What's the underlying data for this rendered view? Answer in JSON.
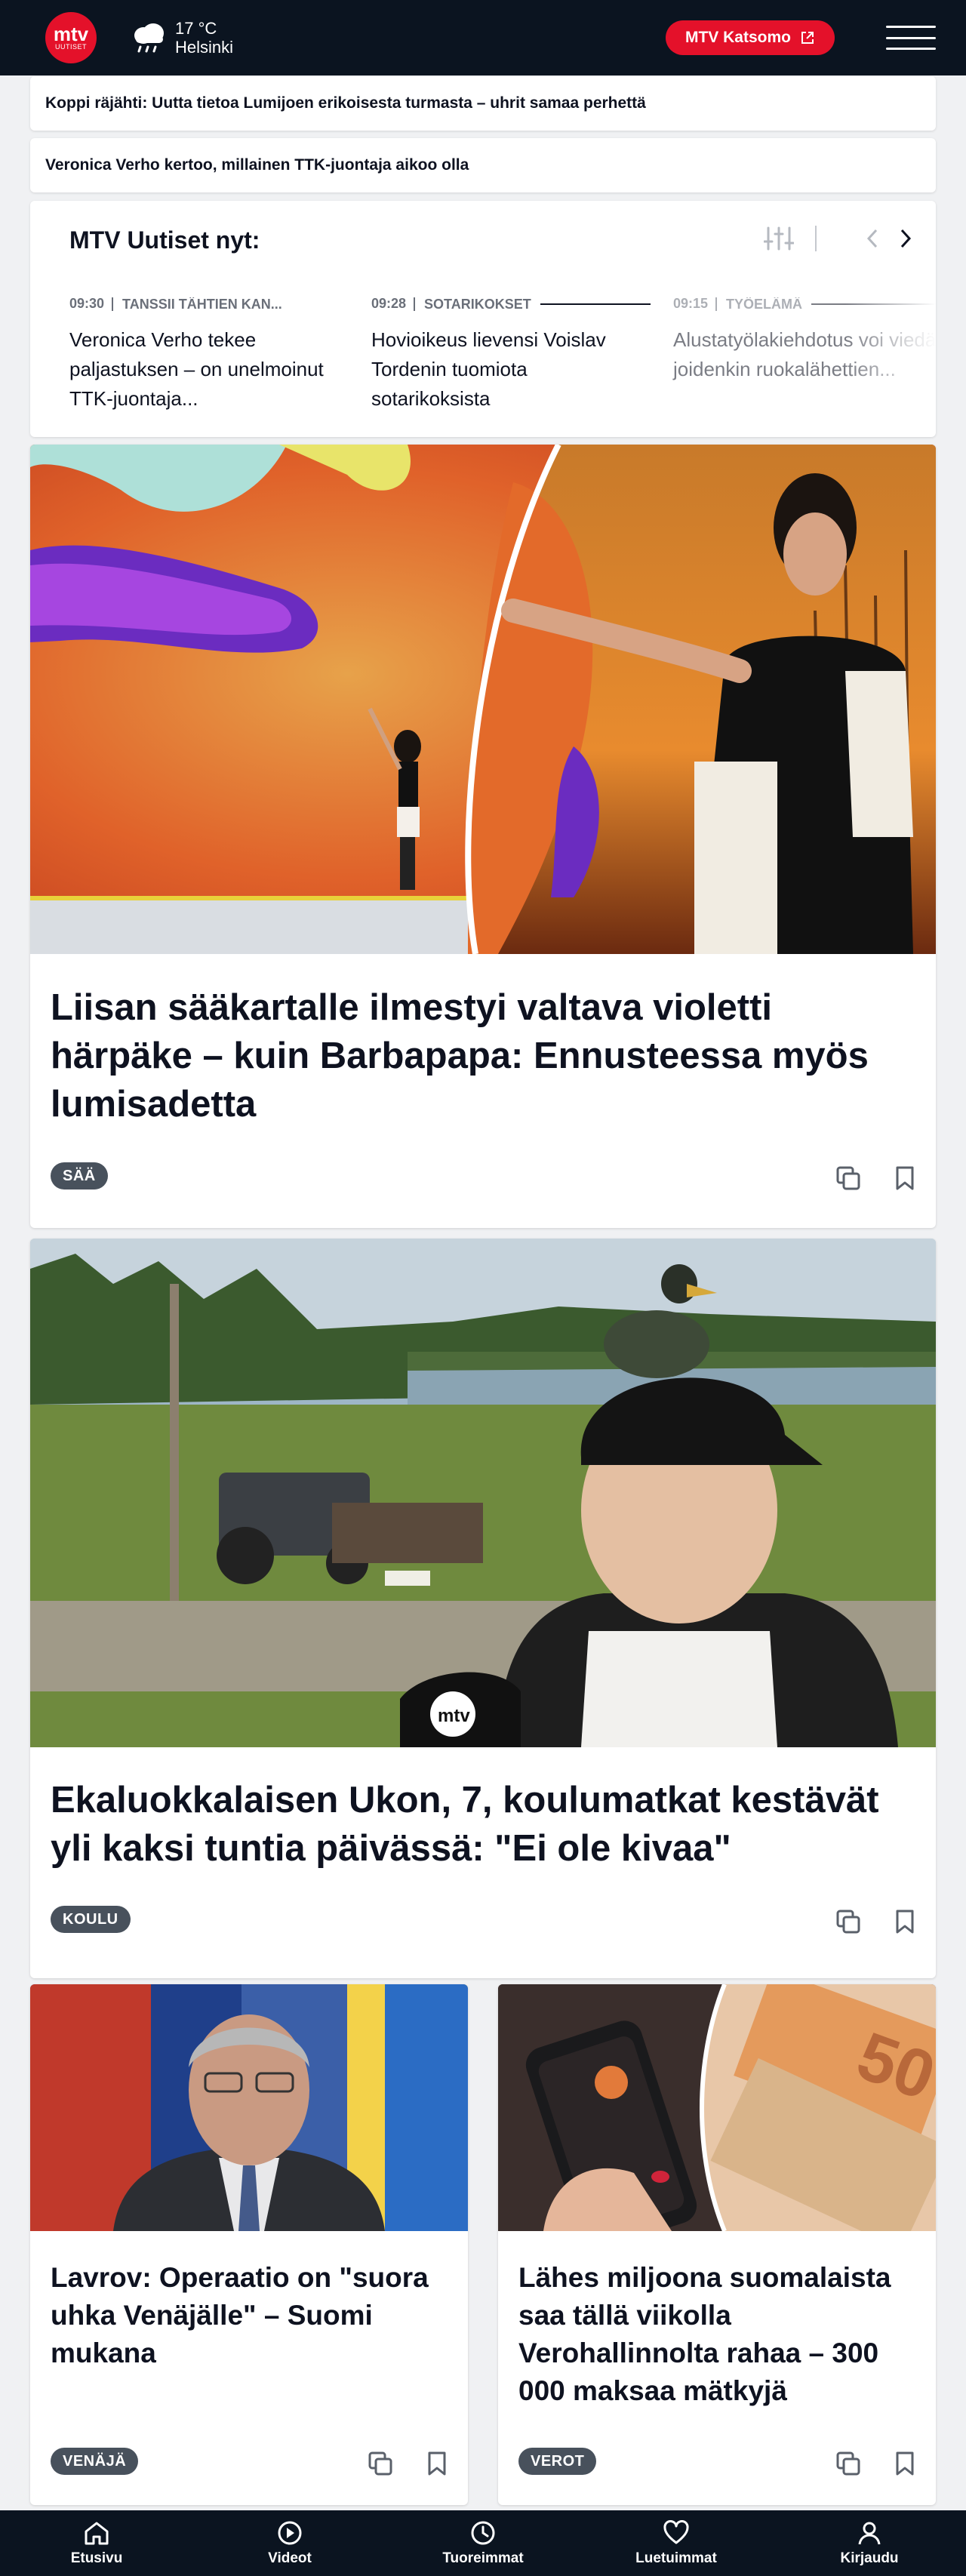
{
  "header": {
    "logo_top": "mtv",
    "logo_bottom": "UUTISET",
    "weather_temp": "17 °C",
    "weather_city": "Helsinki",
    "katsomo_label": "MTV Katsomo"
  },
  "breaking": [
    "Koppi räjähti: Uutta tietoa Lumijoen erikoisesta turmasta – uhrit samaa perhettä",
    "Veronica Verho kertoo, millainen TTK-juontaja aikoo olla"
  ],
  "now": {
    "title": "MTV Uutiset nyt:",
    "items": [
      {
        "time": "09:30",
        "category": "TANSSII TÄHTIEN KAN...",
        "headline": "Veronica Verho tekee paljastuksen – on unelmoinut TTK-juontaja..."
      },
      {
        "time": "09:28",
        "category": "SOTARIKOKSET",
        "headline": "Hovioikeus lievensi Voislav Tordenin tuomiota sotarikoksista"
      },
      {
        "time": "09:15",
        "category": "TYÖELÄMÄ",
        "headline": "Alustatyölakiehdotus voi viedä joidenkin ruokalähettien..."
      }
    ]
  },
  "articles": [
    {
      "title": "Liisan sääkartalle ilmestyi valtava violetti härpäke – kuin Barbapapa: Ennusteessa myös lumisadetta",
      "tag": "SÄÄ"
    },
    {
      "title": "Ekaluokkalaisen Ukon, 7, koulumatkat kestävät yli kaksi tuntia päivässä: \"Ei ole kivaa\"",
      "tag": "KOULU"
    },
    {
      "title": "Lavrov: Operaatio on \"suora uhka Venäjälle\" – Suomi mukana",
      "tag": "VENÄJÄ"
    },
    {
      "title": "Lähes miljoona suomalaista saa tällä viikolla Verohallinnolta rahaa – 300 000 maksaa mätkyjä",
      "tag": "VEROT"
    }
  ],
  "nav": [
    "Etusivu",
    "Videot",
    "Tuoreimmat",
    "Luetuimmat",
    "Kirjaudu"
  ],
  "colors": {
    "brand": "#e4112a",
    "dark": "#0b1420",
    "tag": "#48515c"
  }
}
